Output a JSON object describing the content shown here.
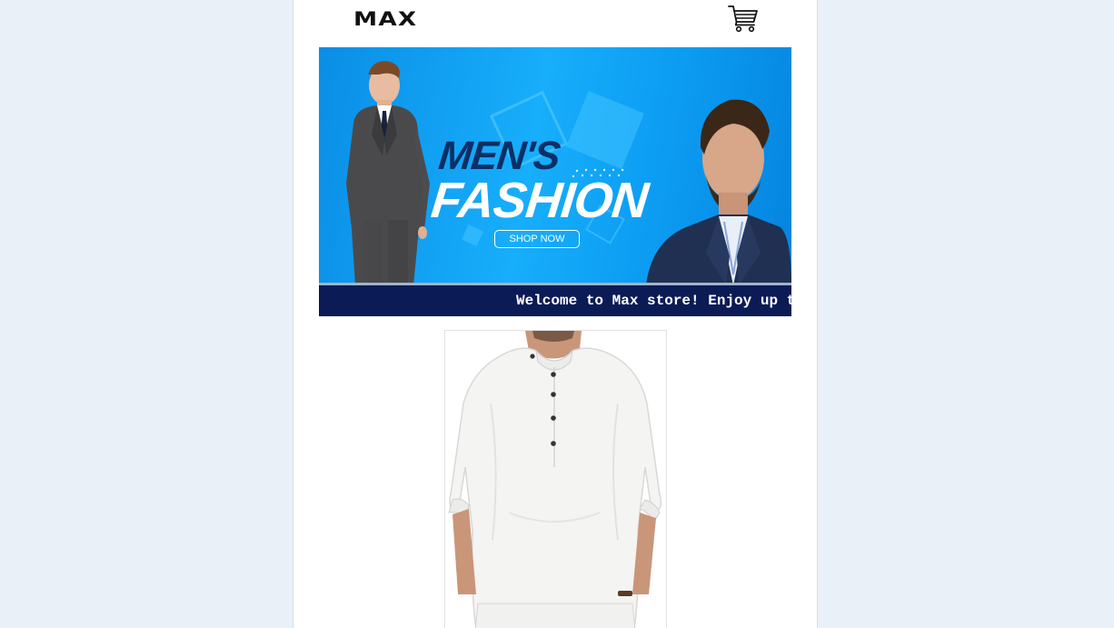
{
  "header": {
    "logo": "MAX",
    "cart_icon": "shopping-cart-icon"
  },
  "banner": {
    "headline_line1": "MEN'S",
    "headline_line2": "FASHION",
    "cta_label": "SHOP NOW"
  },
  "announcement": {
    "text": "Welcome to Max store! Enjoy up to"
  },
  "product": {
    "image_icon": "white-linen-shirt-image"
  },
  "colors": {
    "page_background": "#eaf0f8",
    "banner_blue": "#17aefb",
    "headline_navy": "#0b2f66",
    "announcement_bar": "#0b1b55"
  }
}
